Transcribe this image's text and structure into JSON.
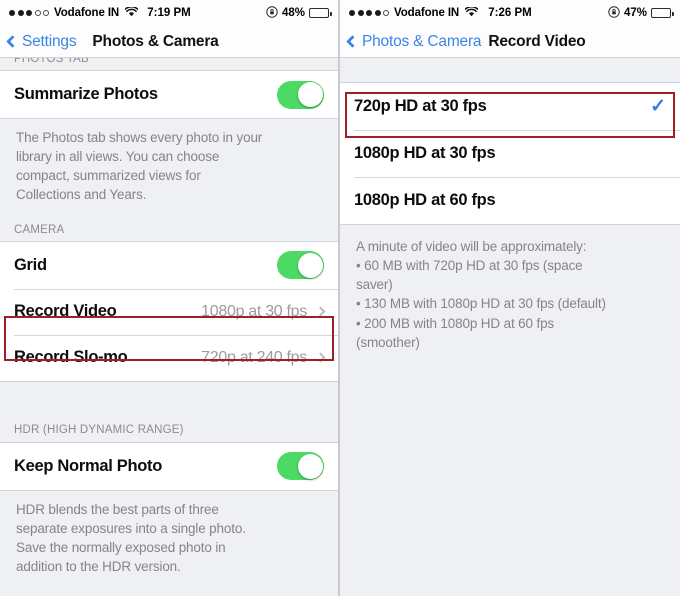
{
  "left": {
    "status": {
      "signal_filled": 3,
      "signal_total": 5,
      "carrier": "Vodafone IN",
      "time": "7:19 PM",
      "battery_percent": "48%",
      "battery_level": 48
    },
    "nav": {
      "back_label": "Settings",
      "title": "Photos & Camera"
    },
    "photos_tab_header": "PHOTOS TAB",
    "summarize": {
      "label": "Summarize Photos",
      "toggle_on": true
    },
    "photos_footer": [
      "The Photos tab shows every photo in your",
      "library in all views. You can choose",
      "compact, summarized views for",
      "Collections and Years."
    ],
    "camera_header": "CAMERA",
    "camera_rows": [
      {
        "label": "Grid",
        "type": "toggle",
        "toggle_on": true
      },
      {
        "label": "Record Video",
        "type": "value",
        "value": "1080p at 30 fps",
        "highlighted": true
      },
      {
        "label": "Record Slo-mo",
        "type": "value",
        "value": "720p at 240 fps",
        "highlighted": false
      }
    ],
    "hdr_header": "HDR (HIGH DYNAMIC RANGE)",
    "hdr_row": {
      "label": "Keep Normal Photo",
      "toggle_on": true
    },
    "hdr_footer": [
      "HDR blends the best parts of three",
      "separate exposures into a single photo.",
      "Save the normally exposed photo in",
      "addition to the HDR version."
    ]
  },
  "right": {
    "status": {
      "signal_filled": 4,
      "signal_total": 5,
      "carrier": "Vodafone IN",
      "time": "7:26 PM",
      "battery_percent": "47%",
      "battery_level": 47
    },
    "nav": {
      "back_label": "Photos & Camera",
      "title": "Record Video"
    },
    "options": [
      {
        "label": "720p HD at 30 fps",
        "selected": true,
        "highlighted": true
      },
      {
        "label": "1080p HD at 30 fps",
        "selected": false,
        "highlighted": false
      },
      {
        "label": "1080p HD at 60 fps",
        "selected": false,
        "highlighted": false
      }
    ],
    "checkmark_glyph": "✓",
    "footer": [
      "A minute of video will be approximately:",
      "• 60 MB with 720p HD at 30 fps (space",
      "saver)",
      "• 130 MB with 1080p HD at 30 fps (default)",
      "• 200 MB with 1080p HD at 60 fps",
      "(smoother)"
    ]
  },
  "colors": {
    "toggle_green": "#4cd964",
    "accent_blue": "#3b85e8",
    "check_blue": "#2b7ff0",
    "highlight_red": "#9e2022",
    "group_bg": "#eff0f4"
  }
}
